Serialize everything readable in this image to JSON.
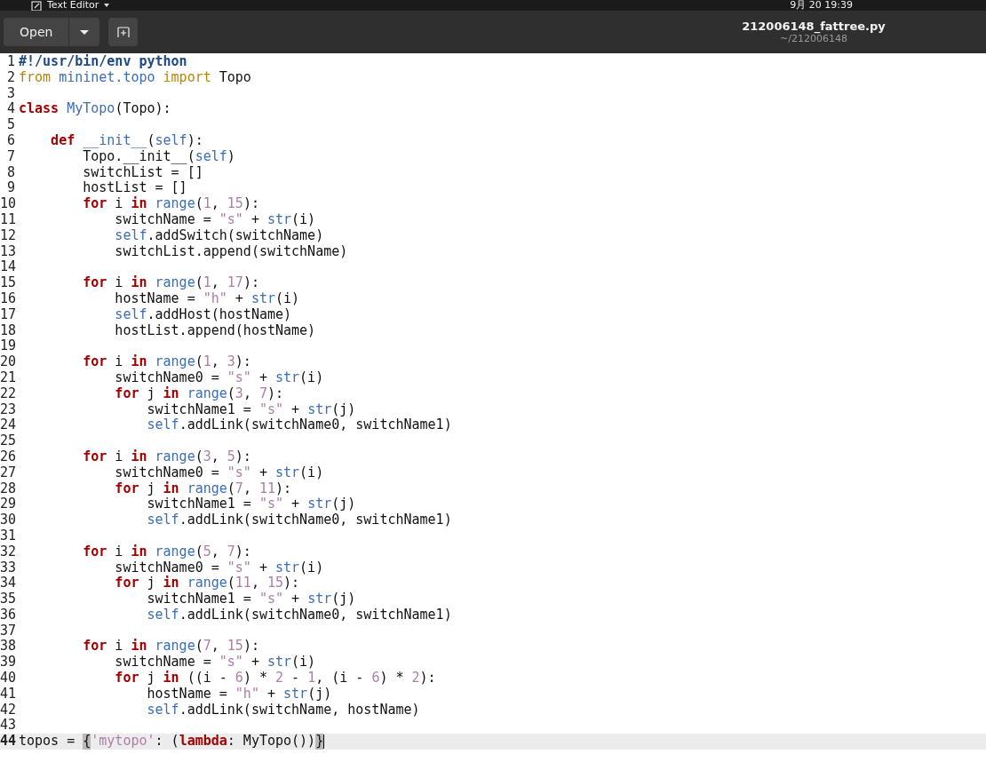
{
  "top_bar": {
    "app_menu": "Text Editor",
    "clock": "9月 20 19:39"
  },
  "header": {
    "open_button": "Open",
    "title": "212006148_fattree.py",
    "subtitle": "~/212006148"
  },
  "editor": {
    "lines": [
      {
        "n": "1",
        "tokens": [
          {
            "text": "#!/usr/bin/env python",
            "kind": "shebang"
          }
        ]
      },
      {
        "n": "2",
        "tokens": [
          {
            "text": "from",
            "kind": "import"
          },
          {
            "text": " mininet.topo",
            "kind": "module"
          },
          {
            "text": " import",
            "kind": "import"
          },
          {
            "text": " Topo",
            "kind": "plain"
          }
        ]
      },
      {
        "n": "3"
      },
      {
        "n": "4",
        "tokens": [
          {
            "text": "class",
            "kind": "keyword"
          },
          {
            "text": " MyTopo",
            "kind": "name"
          },
          {
            "text": "(Topo):",
            "kind": "plain"
          }
        ]
      },
      {
        "n": "5"
      },
      {
        "n": "6",
        "tokens": [
          {
            "text": "    def",
            "kind": "keyword"
          },
          {
            "text": " __init__",
            "kind": "name"
          },
          {
            "text": "(",
            "kind": "plain"
          },
          {
            "text": "self",
            "kind": "name"
          },
          {
            "text": "):",
            "kind": "plain"
          }
        ]
      },
      {
        "n": "7",
        "tokens": [
          {
            "text": "        Topo.__init__(",
            "kind": "plain"
          },
          {
            "text": "self",
            "kind": "name"
          },
          {
            "text": ")",
            "kind": "plain"
          }
        ]
      },
      {
        "n": "8",
        "tokens": [
          {
            "text": "        switchList = []",
            "kind": "plain"
          }
        ]
      },
      {
        "n": "9",
        "tokens": [
          {
            "text": "        hostList = []",
            "kind": "plain"
          }
        ]
      },
      {
        "n": "10",
        "tokens": [
          {
            "text": "        for",
            "kind": "keyword"
          },
          {
            "text": " i ",
            "kind": "plain"
          },
          {
            "text": "in",
            "kind": "keyword"
          },
          {
            "text": " range",
            "kind": "name"
          },
          {
            "text": "(",
            "kind": "plain"
          },
          {
            "text": "1",
            "kind": "number"
          },
          {
            "text": ", ",
            "kind": "plain"
          },
          {
            "text": "15",
            "kind": "number"
          },
          {
            "text": "):",
            "kind": "plain"
          }
        ]
      },
      {
        "n": "11",
        "tokens": [
          {
            "text": "            switchName = ",
            "kind": "plain"
          },
          {
            "text": "\"s\"",
            "kind": "string"
          },
          {
            "text": " + ",
            "kind": "plain"
          },
          {
            "text": "str",
            "kind": "name"
          },
          {
            "text": "(i)",
            "kind": "plain"
          }
        ]
      },
      {
        "n": "12",
        "tokens": [
          {
            "text": "            self",
            "kind": "name"
          },
          {
            "text": ".addSwitch(switchName)",
            "kind": "plain"
          }
        ]
      },
      {
        "n": "13",
        "tokens": [
          {
            "text": "            switchList.append(switchName)",
            "kind": "plain"
          }
        ]
      },
      {
        "n": "14"
      },
      {
        "n": "15",
        "tokens": [
          {
            "text": "        for",
            "kind": "keyword"
          },
          {
            "text": " i ",
            "kind": "plain"
          },
          {
            "text": "in",
            "kind": "keyword"
          },
          {
            "text": " range",
            "kind": "name"
          },
          {
            "text": "(",
            "kind": "plain"
          },
          {
            "text": "1",
            "kind": "number"
          },
          {
            "text": ", ",
            "kind": "plain"
          },
          {
            "text": "17",
            "kind": "number"
          },
          {
            "text": "):",
            "kind": "plain"
          }
        ]
      },
      {
        "n": "16",
        "tokens": [
          {
            "text": "            hostName = ",
            "kind": "plain"
          },
          {
            "text": "\"h\"",
            "kind": "string"
          },
          {
            "text": " + ",
            "kind": "plain"
          },
          {
            "text": "str",
            "kind": "name"
          },
          {
            "text": "(i)",
            "kind": "plain"
          }
        ]
      },
      {
        "n": "17",
        "tokens": [
          {
            "text": "            self",
            "kind": "name"
          },
          {
            "text": ".addHost(hostName)",
            "kind": "plain"
          }
        ]
      },
      {
        "n": "18",
        "tokens": [
          {
            "text": "            hostList.append(hostName)",
            "kind": "plain"
          }
        ]
      },
      {
        "n": "19"
      },
      {
        "n": "20",
        "tokens": [
          {
            "text": "        for",
            "kind": "keyword"
          },
          {
            "text": " i ",
            "kind": "plain"
          },
          {
            "text": "in",
            "kind": "keyword"
          },
          {
            "text": " range",
            "kind": "name"
          },
          {
            "text": "(",
            "kind": "plain"
          },
          {
            "text": "1",
            "kind": "number"
          },
          {
            "text": ", ",
            "kind": "plain"
          },
          {
            "text": "3",
            "kind": "number"
          },
          {
            "text": "):",
            "kind": "plain"
          }
        ]
      },
      {
        "n": "21",
        "tokens": [
          {
            "text": "            switchName0 = ",
            "kind": "plain"
          },
          {
            "text": "\"s\"",
            "kind": "string"
          },
          {
            "text": " + ",
            "kind": "plain"
          },
          {
            "text": "str",
            "kind": "name"
          },
          {
            "text": "(i)",
            "kind": "plain"
          }
        ]
      },
      {
        "n": "22",
        "tokens": [
          {
            "text": "            for",
            "kind": "keyword"
          },
          {
            "text": " j ",
            "kind": "plain"
          },
          {
            "text": "in",
            "kind": "keyword"
          },
          {
            "text": " range",
            "kind": "name"
          },
          {
            "text": "(",
            "kind": "plain"
          },
          {
            "text": "3",
            "kind": "number"
          },
          {
            "text": ", ",
            "kind": "plain"
          },
          {
            "text": "7",
            "kind": "number"
          },
          {
            "text": "):",
            "kind": "plain"
          }
        ]
      },
      {
        "n": "23",
        "tokens": [
          {
            "text": "                switchName1 = ",
            "kind": "plain"
          },
          {
            "text": "\"s\"",
            "kind": "string"
          },
          {
            "text": " + ",
            "kind": "plain"
          },
          {
            "text": "str",
            "kind": "name"
          },
          {
            "text": "(j)",
            "kind": "plain"
          }
        ]
      },
      {
        "n": "24",
        "tokens": [
          {
            "text": "                self",
            "kind": "name"
          },
          {
            "text": ".addLink(switchName0, switchName1)",
            "kind": "plain"
          }
        ]
      },
      {
        "n": "25"
      },
      {
        "n": "26",
        "tokens": [
          {
            "text": "        for",
            "kind": "keyword"
          },
          {
            "text": " i ",
            "kind": "plain"
          },
          {
            "text": "in",
            "kind": "keyword"
          },
          {
            "text": " range",
            "kind": "name"
          },
          {
            "text": "(",
            "kind": "plain"
          },
          {
            "text": "3",
            "kind": "number"
          },
          {
            "text": ", ",
            "kind": "plain"
          },
          {
            "text": "5",
            "kind": "number"
          },
          {
            "text": "):",
            "kind": "plain"
          }
        ]
      },
      {
        "n": "27",
        "tokens": [
          {
            "text": "            switchName0 = ",
            "kind": "plain"
          },
          {
            "text": "\"s\"",
            "kind": "string"
          },
          {
            "text": " + ",
            "kind": "plain"
          },
          {
            "text": "str",
            "kind": "name"
          },
          {
            "text": "(i)",
            "kind": "plain"
          }
        ]
      },
      {
        "n": "28",
        "tokens": [
          {
            "text": "            for",
            "kind": "keyword"
          },
          {
            "text": " j ",
            "kind": "plain"
          },
          {
            "text": "in",
            "kind": "keyword"
          },
          {
            "text": " range",
            "kind": "name"
          },
          {
            "text": "(",
            "kind": "plain"
          },
          {
            "text": "7",
            "kind": "number"
          },
          {
            "text": ", ",
            "kind": "plain"
          },
          {
            "text": "11",
            "kind": "number"
          },
          {
            "text": "):",
            "kind": "plain"
          }
        ]
      },
      {
        "n": "29",
        "tokens": [
          {
            "text": "                switchName1 = ",
            "kind": "plain"
          },
          {
            "text": "\"s\"",
            "kind": "string"
          },
          {
            "text": " + ",
            "kind": "plain"
          },
          {
            "text": "str",
            "kind": "name"
          },
          {
            "text": "(j)",
            "kind": "plain"
          }
        ]
      },
      {
        "n": "30",
        "tokens": [
          {
            "text": "                self",
            "kind": "name"
          },
          {
            "text": ".addLink(switchName0, switchName1)",
            "kind": "plain"
          }
        ]
      },
      {
        "n": "31"
      },
      {
        "n": "32",
        "tokens": [
          {
            "text": "        for",
            "kind": "keyword"
          },
          {
            "text": " i ",
            "kind": "plain"
          },
          {
            "text": "in",
            "kind": "keyword"
          },
          {
            "text": " range",
            "kind": "name"
          },
          {
            "text": "(",
            "kind": "plain"
          },
          {
            "text": "5",
            "kind": "number"
          },
          {
            "text": ", ",
            "kind": "plain"
          },
          {
            "text": "7",
            "kind": "number"
          },
          {
            "text": "):",
            "kind": "plain"
          }
        ]
      },
      {
        "n": "33",
        "tokens": [
          {
            "text": "            switchName0 = ",
            "kind": "plain"
          },
          {
            "text": "\"s\"",
            "kind": "string"
          },
          {
            "text": " + ",
            "kind": "plain"
          },
          {
            "text": "str",
            "kind": "name"
          },
          {
            "text": "(i)",
            "kind": "plain"
          }
        ]
      },
      {
        "n": "34",
        "tokens": [
          {
            "text": "            for",
            "kind": "keyword"
          },
          {
            "text": " j ",
            "kind": "plain"
          },
          {
            "text": "in",
            "kind": "keyword"
          },
          {
            "text": " range",
            "kind": "name"
          },
          {
            "text": "(",
            "kind": "plain"
          },
          {
            "text": "11",
            "kind": "number"
          },
          {
            "text": ", ",
            "kind": "plain"
          },
          {
            "text": "15",
            "kind": "number"
          },
          {
            "text": "):",
            "kind": "plain"
          }
        ]
      },
      {
        "n": "35",
        "tokens": [
          {
            "text": "                switchName1 = ",
            "kind": "plain"
          },
          {
            "text": "\"s\"",
            "kind": "string"
          },
          {
            "text": " + ",
            "kind": "plain"
          },
          {
            "text": "str",
            "kind": "name"
          },
          {
            "text": "(j)",
            "kind": "plain"
          }
        ]
      },
      {
        "n": "36",
        "tokens": [
          {
            "text": "                self",
            "kind": "name"
          },
          {
            "text": ".addLink(switchName0, switchName1)",
            "kind": "plain"
          }
        ]
      },
      {
        "n": "37"
      },
      {
        "n": "38",
        "tokens": [
          {
            "text": "        for",
            "kind": "keyword"
          },
          {
            "text": " i ",
            "kind": "plain"
          },
          {
            "text": "in",
            "kind": "keyword"
          },
          {
            "text": " range",
            "kind": "name"
          },
          {
            "text": "(",
            "kind": "plain"
          },
          {
            "text": "7",
            "kind": "number"
          },
          {
            "text": ", ",
            "kind": "plain"
          },
          {
            "text": "15",
            "kind": "number"
          },
          {
            "text": "):",
            "kind": "plain"
          }
        ]
      },
      {
        "n": "39",
        "tokens": [
          {
            "text": "            switchName = ",
            "kind": "plain"
          },
          {
            "text": "\"s\"",
            "kind": "string"
          },
          {
            "text": " + ",
            "kind": "plain"
          },
          {
            "text": "str",
            "kind": "name"
          },
          {
            "text": "(i)",
            "kind": "plain"
          }
        ]
      },
      {
        "n": "40",
        "tokens": [
          {
            "text": "            for",
            "kind": "keyword"
          },
          {
            "text": " j ",
            "kind": "plain"
          },
          {
            "text": "in",
            "kind": "keyword"
          },
          {
            "text": " ((i - ",
            "kind": "plain"
          },
          {
            "text": "6",
            "kind": "number"
          },
          {
            "text": ") * ",
            "kind": "plain"
          },
          {
            "text": "2",
            "kind": "number"
          },
          {
            "text": " - ",
            "kind": "plain"
          },
          {
            "text": "1",
            "kind": "number"
          },
          {
            "text": ", (i - ",
            "kind": "plain"
          },
          {
            "text": "6",
            "kind": "number"
          },
          {
            "text": ") * ",
            "kind": "plain"
          },
          {
            "text": "2",
            "kind": "number"
          },
          {
            "text": "):",
            "kind": "plain"
          }
        ]
      },
      {
        "n": "41",
        "tokens": [
          {
            "text": "                hostName = ",
            "kind": "plain"
          },
          {
            "text": "\"h\"",
            "kind": "string"
          },
          {
            "text": " + ",
            "kind": "plain"
          },
          {
            "text": "str",
            "kind": "name"
          },
          {
            "text": "(j)",
            "kind": "plain"
          }
        ]
      },
      {
        "n": "42",
        "tokens": [
          {
            "text": "                self",
            "kind": "name"
          },
          {
            "text": ".addLink(switchName, hostName)",
            "kind": "plain"
          }
        ]
      },
      {
        "n": "43"
      },
      {
        "n": "44",
        "current": true,
        "tokens": [
          {
            "text": "topos = ",
            "kind": "plain"
          },
          {
            "text": "{",
            "kind": "match"
          },
          {
            "text": "'mytopo'",
            "kind": "string"
          },
          {
            "text": ": (",
            "kind": "plain"
          },
          {
            "text": "lambda",
            "kind": "keyword"
          },
          {
            "text": ": MyTopo())",
            "kind": "plain"
          },
          {
            "text": "}",
            "kind": "match"
          }
        ]
      }
    ]
  }
}
